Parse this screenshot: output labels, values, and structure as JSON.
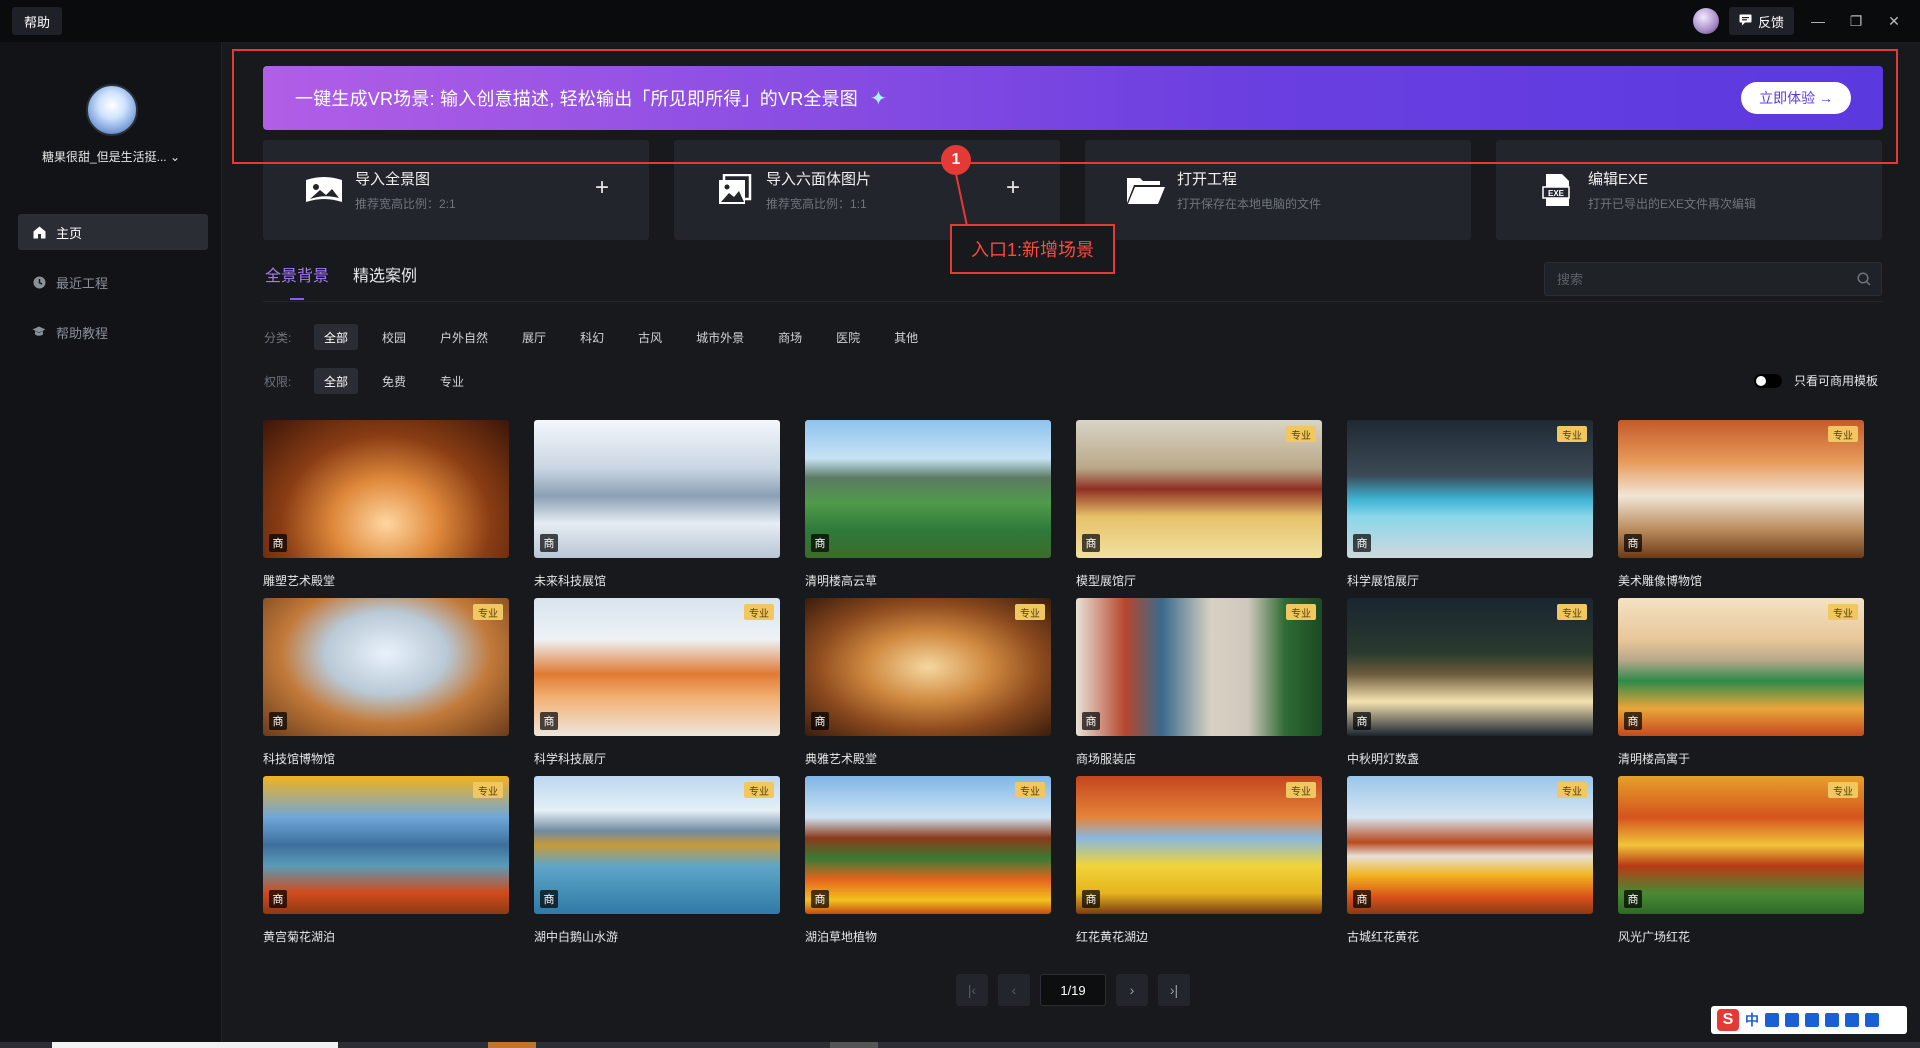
{
  "titlebar": {
    "help": "帮助",
    "feedback": "反馈"
  },
  "sidebar": {
    "username": "糖果很甜_但是生活挺... ⌄",
    "items": [
      {
        "label": "主页",
        "icon": "home-icon",
        "active": true
      },
      {
        "label": "最近工程",
        "icon": "clock-icon",
        "active": false
      },
      {
        "label": "帮助教程",
        "icon": "graduation-cap-icon",
        "active": false
      }
    ]
  },
  "banner": {
    "text": "一键生成VR场景: 输入创意描述, 轻松输出「所见即所得」的VR全景图",
    "button": "立即体验 →"
  },
  "annotation": {
    "number": "1",
    "label": "入口1:新增场景"
  },
  "actions": [
    {
      "title": "导入全景图",
      "sub": "推荐宽高比例：2:1",
      "plus": "+"
    },
    {
      "title": "导入六面体图片",
      "sub": "推荐宽高比例：1:1",
      "plus": "+"
    },
    {
      "title": "打开工程",
      "sub": "打开保存在本地电脑的文件"
    },
    {
      "title": "编辑EXE",
      "sub": "打开已导出的EXE文件再次编辑"
    }
  ],
  "tabs": [
    {
      "label": "全景背景",
      "active": true
    },
    {
      "label": "精选案例",
      "active": false
    }
  ],
  "search": {
    "placeholder": "搜索"
  },
  "filters": {
    "category_label": "分类:",
    "categories": [
      "全部",
      "校园",
      "户外自然",
      "展厅",
      "科幻",
      "古风",
      "城市外景",
      "商场",
      "医院",
      "其他"
    ],
    "permission_label": "权限:",
    "permissions": [
      "全部",
      "免费",
      "专业"
    ]
  },
  "toggle": {
    "label": "只看可商用模板",
    "on": false
  },
  "badges": {
    "commercial": "商",
    "pro": "专业"
  },
  "templates": [
    {
      "title": "雕塑艺术殿堂",
      "pro": false
    },
    {
      "title": "未来科技展馆",
      "pro": false
    },
    {
      "title": "清明楼高云草",
      "pro": false
    },
    {
      "title": "模型展馆厅",
      "pro": true
    },
    {
      "title": "科学展馆展厅",
      "pro": true
    },
    {
      "title": "美术雕像博物馆",
      "pro": true
    },
    {
      "title": "科技馆博物馆",
      "pro": true
    },
    {
      "title": "科学科技展厅",
      "pro": true
    },
    {
      "title": "典雅艺术殿堂",
      "pro": true
    },
    {
      "title": "商场服装店",
      "pro": true
    },
    {
      "title": "中秋明灯数盏",
      "pro": true
    },
    {
      "title": "清明楼高寓于",
      "pro": true
    },
    {
      "title": "黄宫菊花湖泊",
      "pro": true
    },
    {
      "title": "湖中白鹅山水游",
      "pro": true
    },
    {
      "title": "湖泊草地植物",
      "pro": true
    },
    {
      "title": "红花黄花湖边",
      "pro": true
    },
    {
      "title": "古城红花黄花",
      "pro": true
    },
    {
      "title": "风光广场红花",
      "pro": true
    }
  ],
  "pagination": {
    "current": "1/19",
    "first": "|‹",
    "prev": "‹",
    "next": "›",
    "last": "›|"
  },
  "ime": {
    "logo": "S",
    "lang": "中"
  }
}
